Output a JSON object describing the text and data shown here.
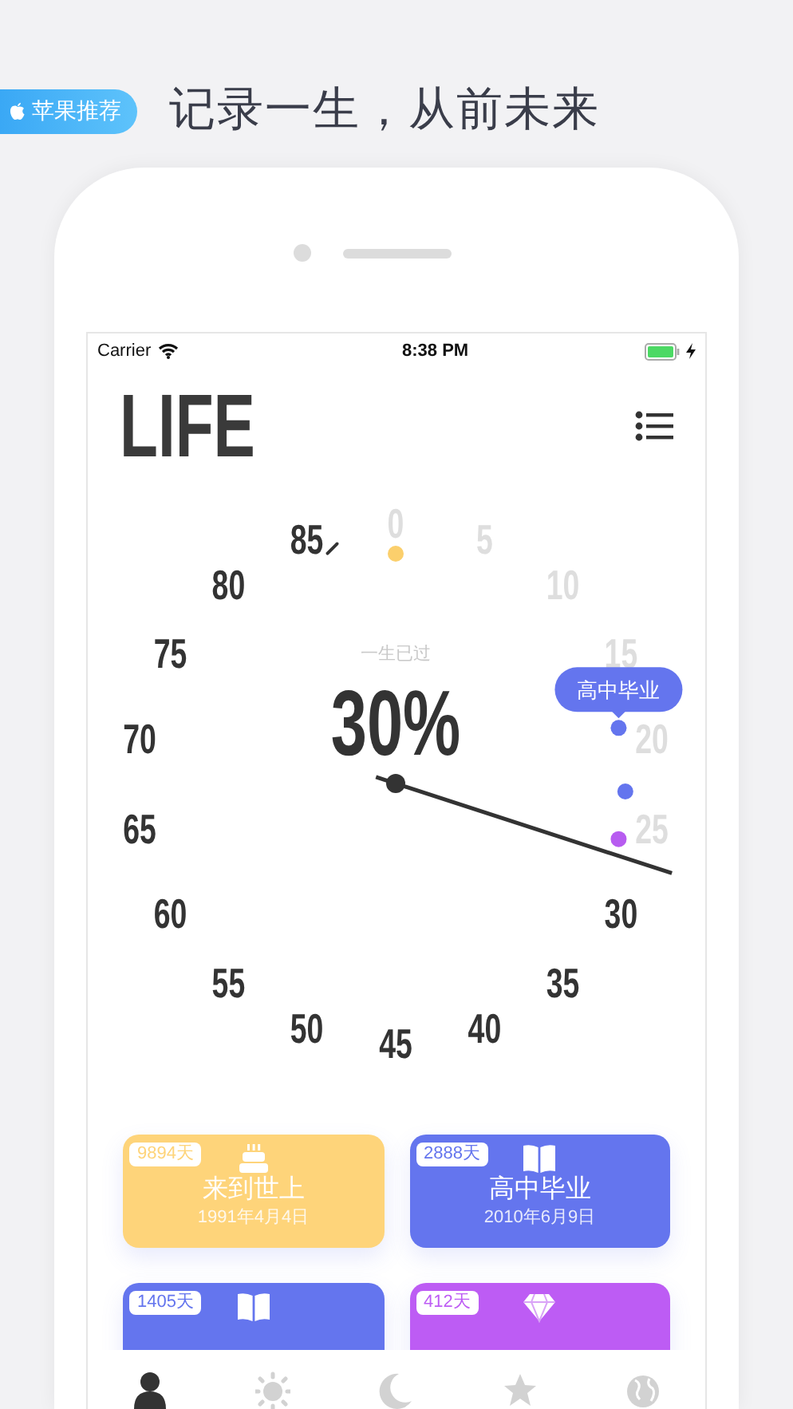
{
  "promo": {
    "badge": "苹果推荐",
    "headline": "记录一生，从前未来"
  },
  "status_bar": {
    "carrier": "Carrier",
    "time": "8:38 PM"
  },
  "app_title": "LIFE",
  "dial": {
    "labels": [
      {
        "text": "0",
        "faded": true
      },
      {
        "text": "5",
        "faded": true
      },
      {
        "text": "10",
        "faded": true
      },
      {
        "text": "15",
        "faded": true
      },
      {
        "text": "20",
        "faded": true
      },
      {
        "text": "25",
        "faded": true
      },
      {
        "text": "30",
        "faded": false
      },
      {
        "text": "35",
        "faded": false
      },
      {
        "text": "40",
        "faded": false
      },
      {
        "text": "45",
        "faded": false
      },
      {
        "text": "50",
        "faded": false
      },
      {
        "text": "55",
        "faded": false
      },
      {
        "text": "60",
        "faded": false
      },
      {
        "text": "65",
        "faded": false
      },
      {
        "text": "70",
        "faded": false
      },
      {
        "text": "75",
        "faded": false
      },
      {
        "text": "80",
        "faded": false
      },
      {
        "text": "85",
        "faded": false
      }
    ],
    "caption": "一生已过",
    "percent": "30%",
    "markers": [
      {
        "color": "#fbcf6c"
      },
      {
        "color": "#6475ee",
        "tooltip": "高中毕业"
      },
      {
        "color": "#6475ee"
      },
      {
        "color": "#b75cf0"
      }
    ]
  },
  "cards": [
    {
      "days": "9894天",
      "title": "来到世上",
      "date": "1991年4月4日",
      "color": "#fed47a"
    },
    {
      "days": "2888天",
      "title": "高中毕业",
      "date": "2010年6月9日",
      "color": "#6475ee"
    },
    {
      "days": "1405天",
      "color": "#6475ee"
    },
    {
      "days": "412天",
      "color": "#bd5cf4"
    }
  ],
  "tab_bar": [
    {
      "selected": true
    },
    {
      "selected": false
    },
    {
      "selected": false
    },
    {
      "selected": false
    },
    {
      "selected": false
    }
  ]
}
